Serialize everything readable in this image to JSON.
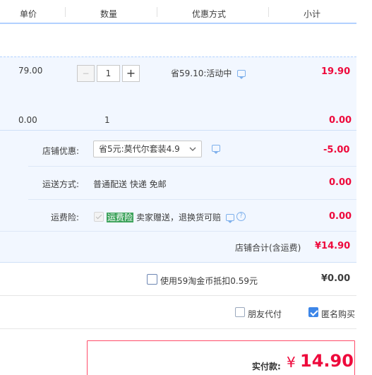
{
  "header": {
    "col_price": "单价",
    "col_qty": "数量",
    "col_promo": "优惠方式",
    "col_subtotal": "小计"
  },
  "item1": {
    "price": "79.00",
    "qty_minus": "−",
    "qty": "1",
    "qty_plus": "+",
    "promo": "省59.10:活动中",
    "subtotal": "19.90"
  },
  "item2": {
    "price": "0.00",
    "qty": "1",
    "subtotal": "0.00"
  },
  "shop": {
    "discount_label": "店铺优惠:",
    "discount_value": "省5元:莫代尔套装4.9",
    "discount_amount": "-5.00",
    "shipping_label": "运送方式:",
    "shipping_value": "普通配送 快递 免邮",
    "shipping_amount": "0.00",
    "insurance_label": "运费险:",
    "insurance_highlight": "运费险",
    "insurance_text": "卖家赠送，退换货可赔",
    "insurance_help": "?",
    "insurance_amount": "0.00",
    "total_label": "店铺合计(含运费)",
    "total_value": "¥14.90"
  },
  "coins": {
    "label": "使用59淘金币抵扣0.59元",
    "value": "¥0.00"
  },
  "options": {
    "friend_pay": "朋友代付",
    "anonymous": "匿名购买"
  },
  "pay": {
    "label": "实付款:",
    "currency": "¥",
    "amount": "14.90"
  },
  "colors": {
    "accent_red": "#ee0a3c",
    "band_blue": "#f2f7ff",
    "checkbox_blue": "#3d86e8",
    "highlight_green": "#3ea35c"
  }
}
